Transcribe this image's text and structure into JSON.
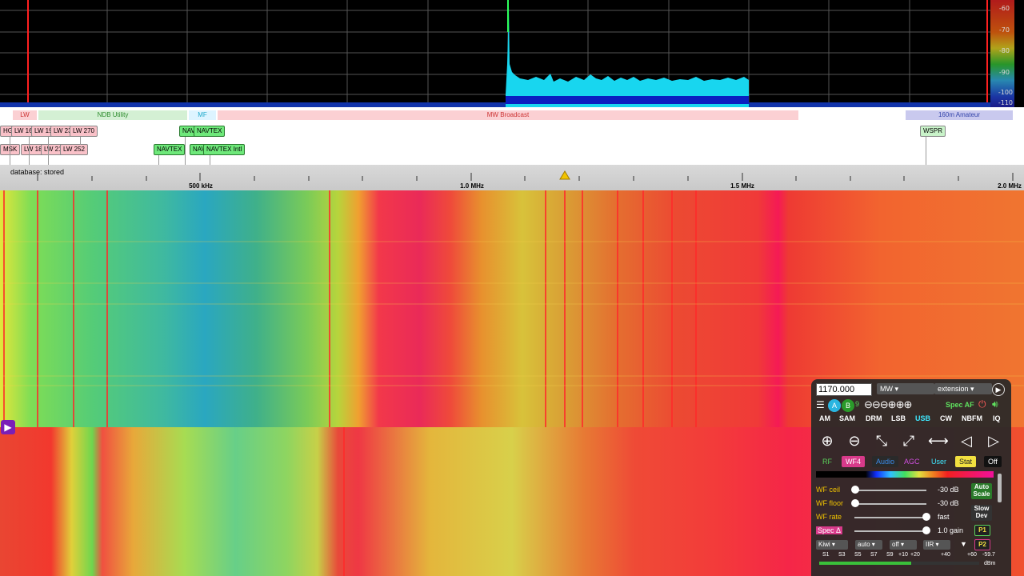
{
  "spectrum": {
    "db_labels": [
      "-60",
      "-70",
      "-80",
      "-90",
      "-100",
      "-110"
    ]
  },
  "bands": [
    {
      "label": "LW",
      "color": "#fbd0d3",
      "text": "#c33"
    },
    {
      "label": "NDB Utility",
      "color": "#d4f0d4",
      "text": "#2a8a2a"
    },
    {
      "label": "MF",
      "color": "#ddf4ff",
      "text": "#22aacc"
    },
    {
      "label": "MW Broadcast",
      "color": "#fbd0d3",
      "text": "#c33"
    },
    {
      "label": "160m Amateur",
      "color": "#c9c9ee",
      "text": "#3344aa"
    }
  ],
  "stations": {
    "row1": [
      "HGA",
      "LW 16",
      "LW 19",
      "LW 23",
      "LW 270",
      "NAV",
      "NAVTEX",
      "WSPR"
    ],
    "row2": [
      "MSK",
      "LW 18",
      "LW 21",
      "LW 252",
      "NAVTEX",
      "NAV",
      "NAVTEX Intl"
    ]
  },
  "scale": {
    "status": "database: stored",
    "labels": [
      "500 kHz",
      "1.0 MHz",
      "1.5 MHz",
      "2.0 MHz"
    ]
  },
  "panel": {
    "frequency": "1170.000",
    "band_select": "MW",
    "extension_select": "extension",
    "spec_af": "Spec AF",
    "modes": [
      "AM",
      "SAM",
      "DRM",
      "LSB",
      "USB",
      "CW",
      "NBFM",
      "IQ"
    ],
    "active_mode": "USB",
    "tabs": [
      "RF",
      "WF4",
      "Audio",
      "AGC",
      "User",
      "Stat",
      "Off"
    ],
    "wf_ceil": {
      "label": "WF ceil",
      "value": "-30 dB"
    },
    "wf_floor": {
      "label": "WF floor",
      "value": "-30 dB"
    },
    "wf_rate": {
      "label": "WF rate",
      "value": "fast"
    },
    "spec": {
      "label": "Spec Δ",
      "value": "1.0 gain"
    },
    "auto_scale": "Auto Scale",
    "slow_dev": "Slow Dev",
    "p1": "P1",
    "p2": "P2",
    "selects": [
      "Kiwi",
      "auto",
      "off",
      "IIR"
    ],
    "smeter": [
      "S1",
      "S3",
      "S5",
      "S7",
      "S9",
      "+10",
      "+20",
      "+40",
      "+60",
      "-59.7"
    ],
    "smeter_unit": "dBm",
    "pane_number": "9"
  },
  "colors": {
    "accent": "#3ee8ff",
    "panel_bg": "#282828",
    "waterfall_red": "#f03a38"
  }
}
